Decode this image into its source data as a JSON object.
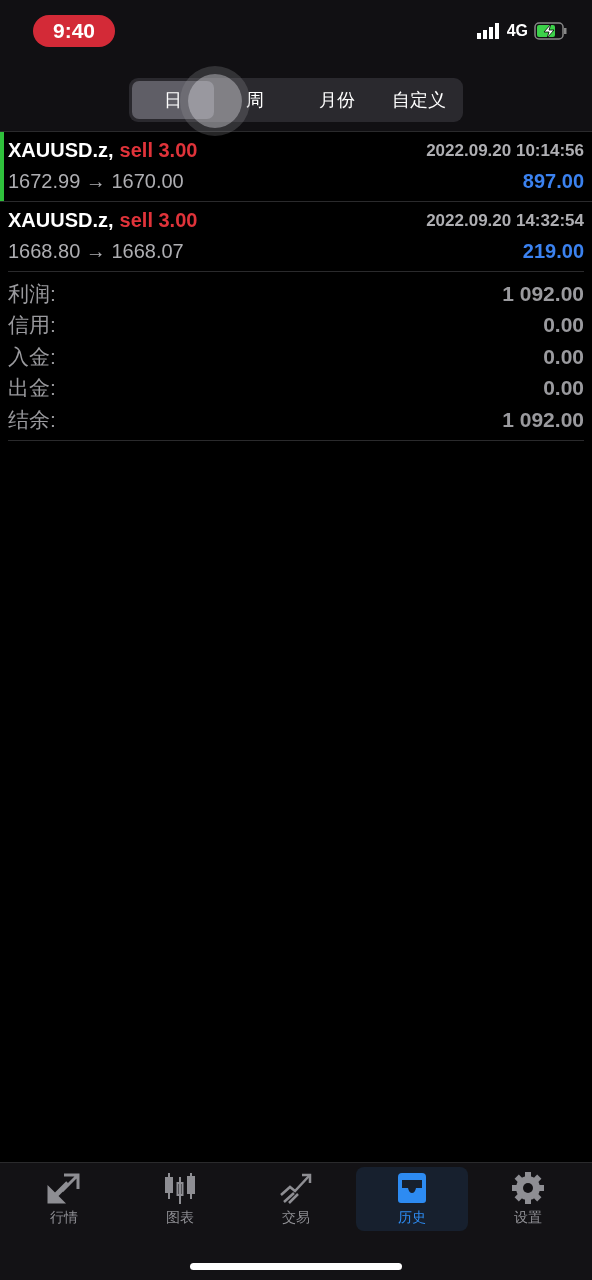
{
  "status_bar": {
    "time": "9:40",
    "network": "4G"
  },
  "period_tabs": [
    {
      "label": "日",
      "selected": true
    },
    {
      "label": "周",
      "selected": false
    },
    {
      "label": "月份",
      "selected": false
    },
    {
      "label": "自定义",
      "selected": false
    }
  ],
  "trades": [
    {
      "symbol": "XAUUSD.z,",
      "side": "sell 3.00",
      "time": "2022.09.20 10:14:56",
      "prices": "1672.99 → 1670.00",
      "profit": "897.00",
      "selected": true
    },
    {
      "symbol": "XAUUSD.z,",
      "side": "sell 3.00",
      "time": "2022.09.20 14:32:54",
      "prices": "1668.80 → 1668.07",
      "profit": "219.00",
      "selected": false
    }
  ],
  "summary": [
    {
      "label": "利润:",
      "value": "1 092.00"
    },
    {
      "label": "信用:",
      "value": "0.00"
    },
    {
      "label": "入金:",
      "value": "0.00"
    },
    {
      "label": "出金:",
      "value": "0.00"
    },
    {
      "label": "结余:",
      "value": "1 092.00"
    }
  ],
  "tab_bar": [
    {
      "kind": "quotes",
      "label": "行情",
      "selected": false
    },
    {
      "kind": "chart",
      "label": "图表",
      "selected": false
    },
    {
      "kind": "trade",
      "label": "交易",
      "selected": false
    },
    {
      "kind": "history",
      "label": "历史",
      "selected": true
    },
    {
      "kind": "settings",
      "label": "设置",
      "selected": false
    }
  ]
}
